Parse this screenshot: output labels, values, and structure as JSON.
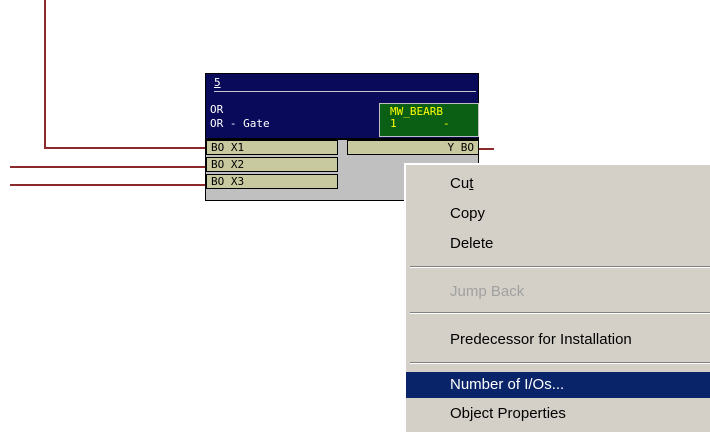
{
  "block": {
    "number": "5",
    "type": "OR",
    "comment": "OR - Gate",
    "tag_name": "MW_BEARB",
    "tag_sub": "1       -",
    "inputs": [
      "BO X1",
      "BO X2",
      "BO X3"
    ],
    "output": "Y BO"
  },
  "context_menu": {
    "items": [
      "Cut",
      "Copy",
      "Delete",
      "Jump Back",
      "Predecessor for Installation",
      "Number of I/Os...",
      "Object Properties"
    ],
    "disabled": [
      "Jump Back"
    ],
    "selected": "Number of I/Os..."
  },
  "colors": {
    "wire": "#8b2a2a",
    "header_bg": "#0a0a5a",
    "tag_bg": "#0a5f14",
    "tag_text": "#ffff00",
    "menu_bg": "#d4d0c8",
    "selection": "#0a246a"
  }
}
